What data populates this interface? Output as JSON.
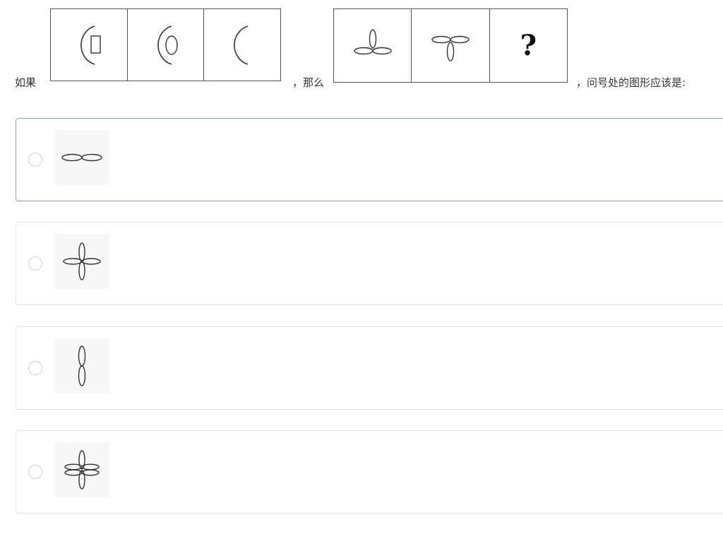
{
  "question": {
    "text_if": "如果",
    "text_then": "，那么",
    "text_ask": "，问号处的图形应该是:",
    "sequence_a_icons": [
      "arc-with-rectangle-icon",
      "arc-with-ellipse-icon",
      "arc-icon"
    ],
    "sequence_b_icons": [
      "three-petal-up-icon",
      "three-petal-down-icon"
    ],
    "unknown_mark": "?"
  },
  "options": [
    {
      "icon": "two-horizontal-petals-icon",
      "selected": true
    },
    {
      "icon": "four-petal-cross-icon",
      "selected": false
    },
    {
      "icon": "two-vertical-petals-icon",
      "selected": false
    },
    {
      "icon": "six-petal-flower-icon",
      "selected": false
    }
  ],
  "colors": {
    "selected_border": "#7da2d8",
    "card_border": "#e3e3e3",
    "figure_stroke": "#333333"
  }
}
